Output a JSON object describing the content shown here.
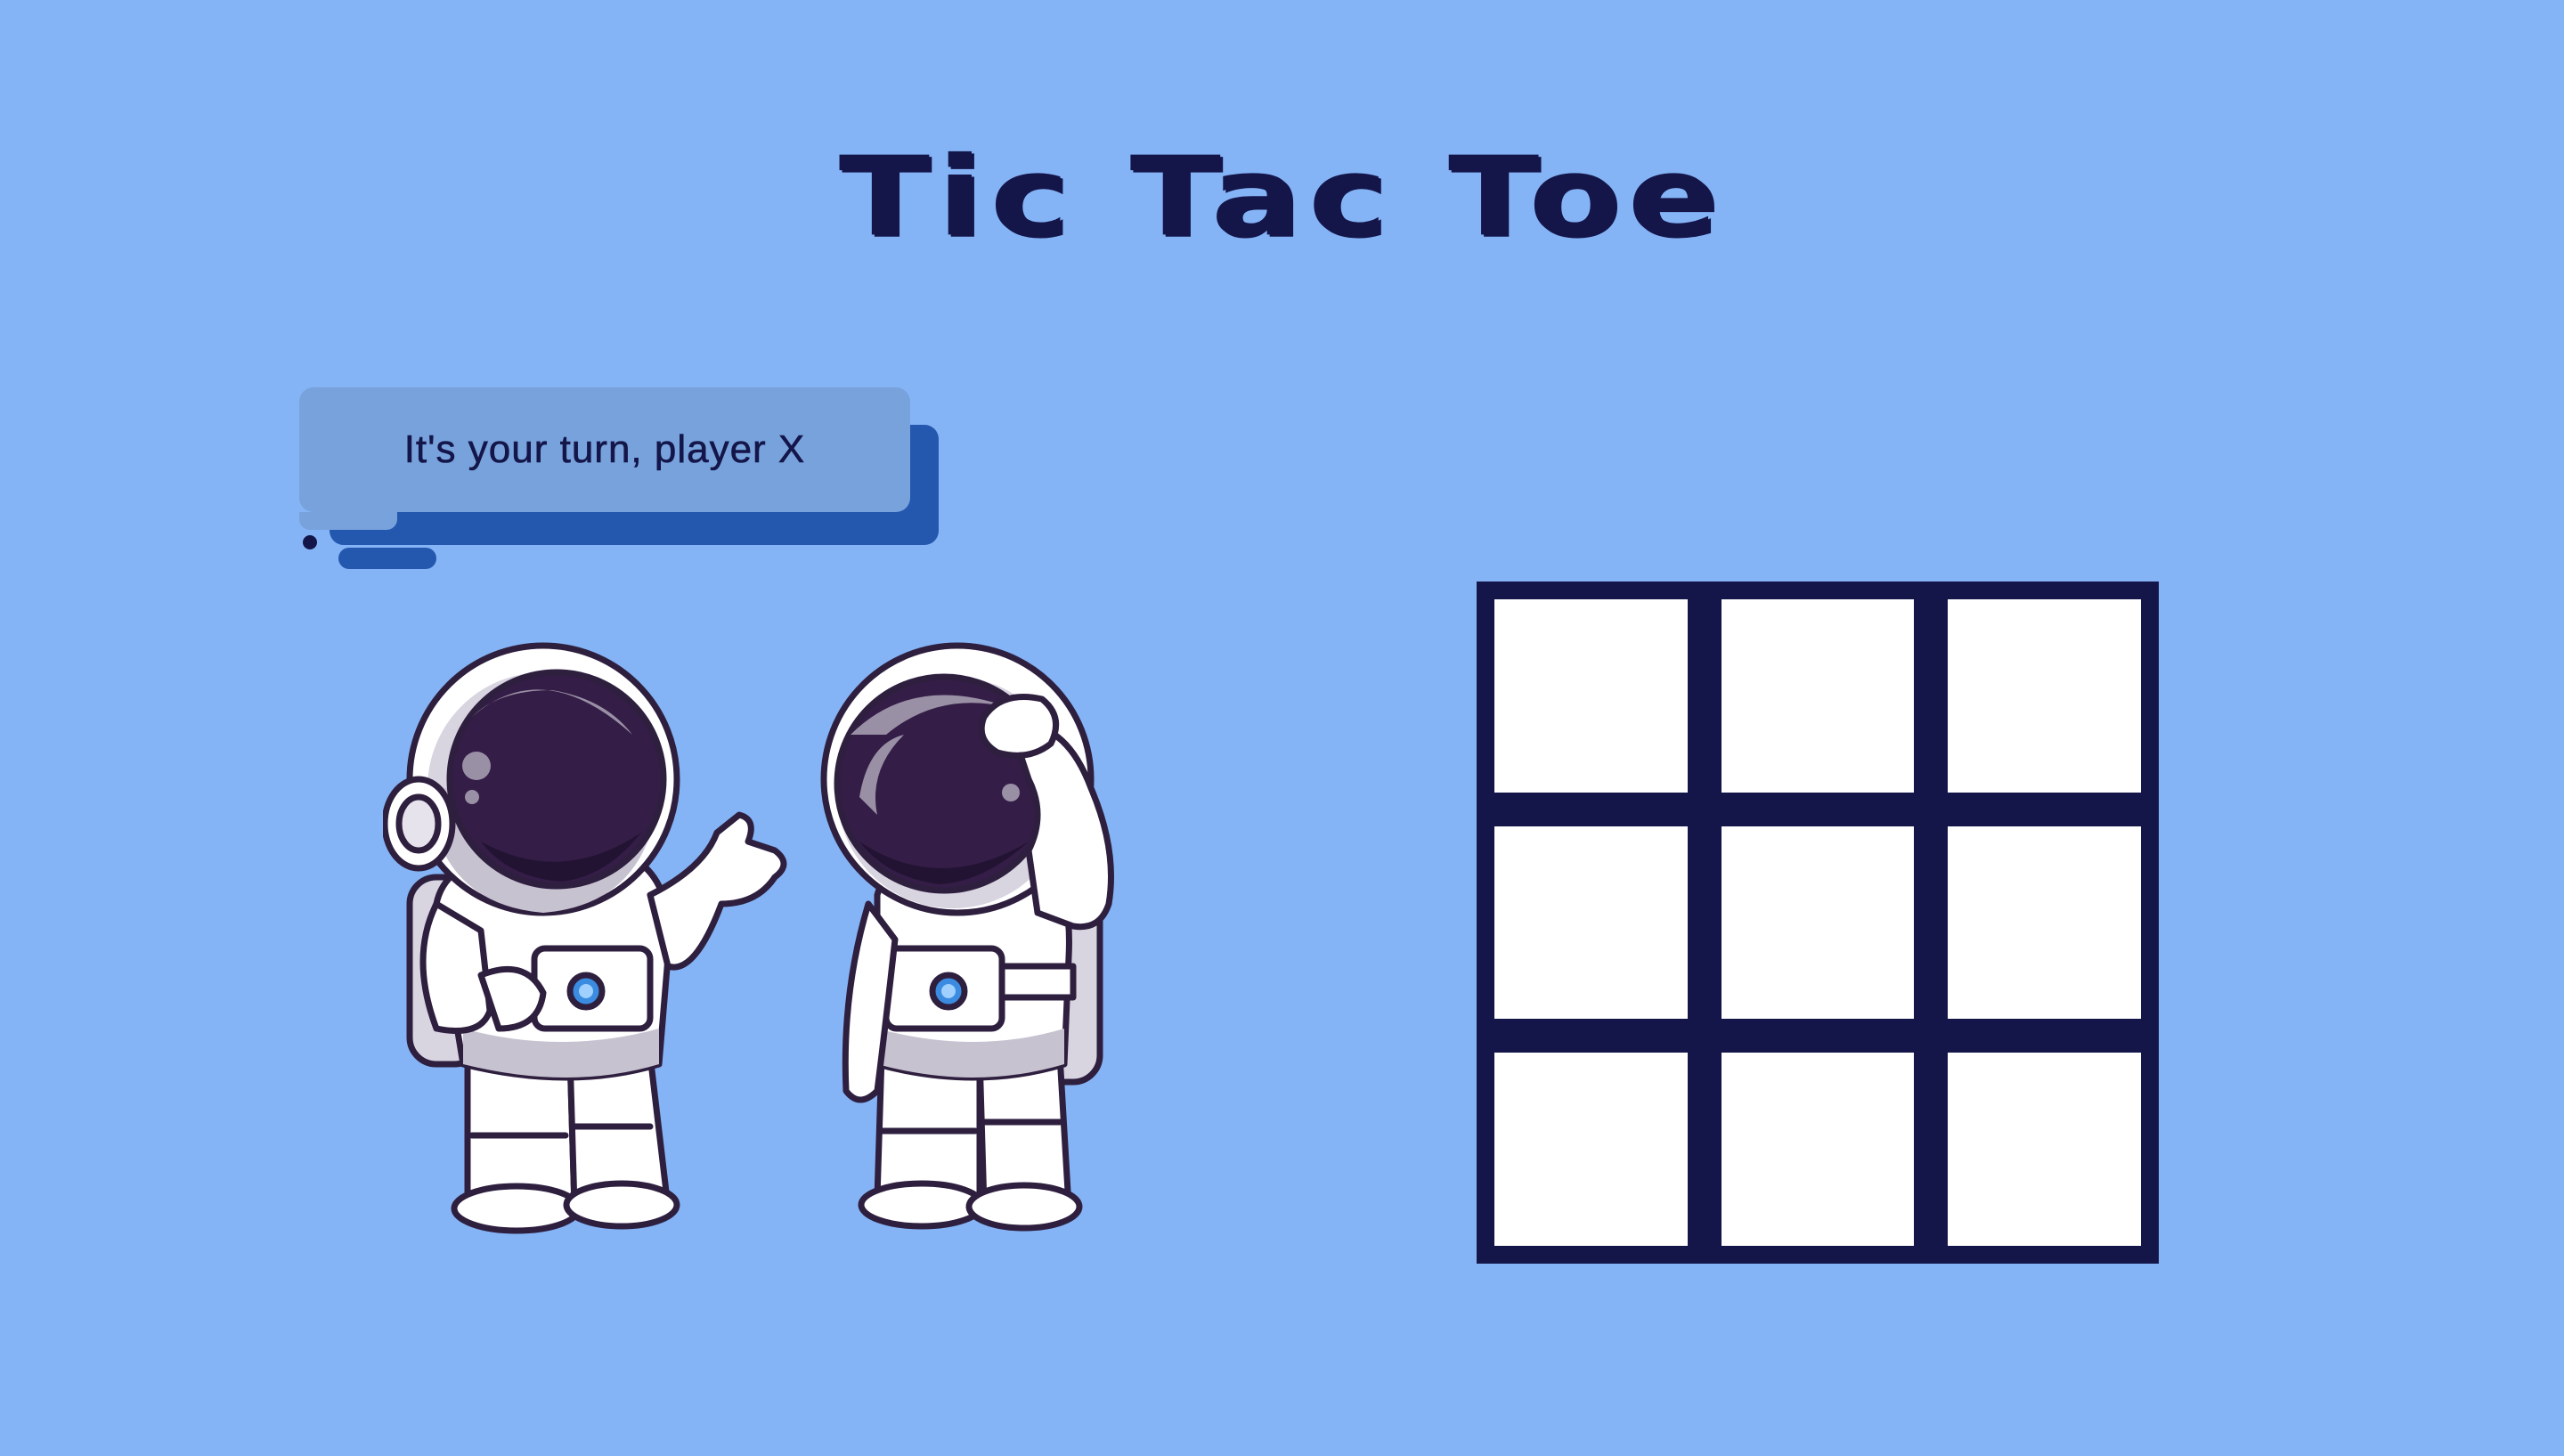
{
  "game": {
    "title": "Tic Tac Toe",
    "status_message": "It's your turn, player X",
    "current_player": "X",
    "board": [
      "",
      "",
      "",
      "",
      "",
      "",
      "",
      "",
      ""
    ]
  },
  "colors": {
    "background": "#85b4f6",
    "title": "#14164a",
    "bubble": "#78a2dc",
    "bubble_shadow": "#2458ae",
    "board_grid": "#14164a",
    "cell": "#ffffff"
  },
  "illustration": {
    "left_figure": "astronaut-pointing-icon",
    "right_figure": "astronaut-saluting-icon"
  }
}
